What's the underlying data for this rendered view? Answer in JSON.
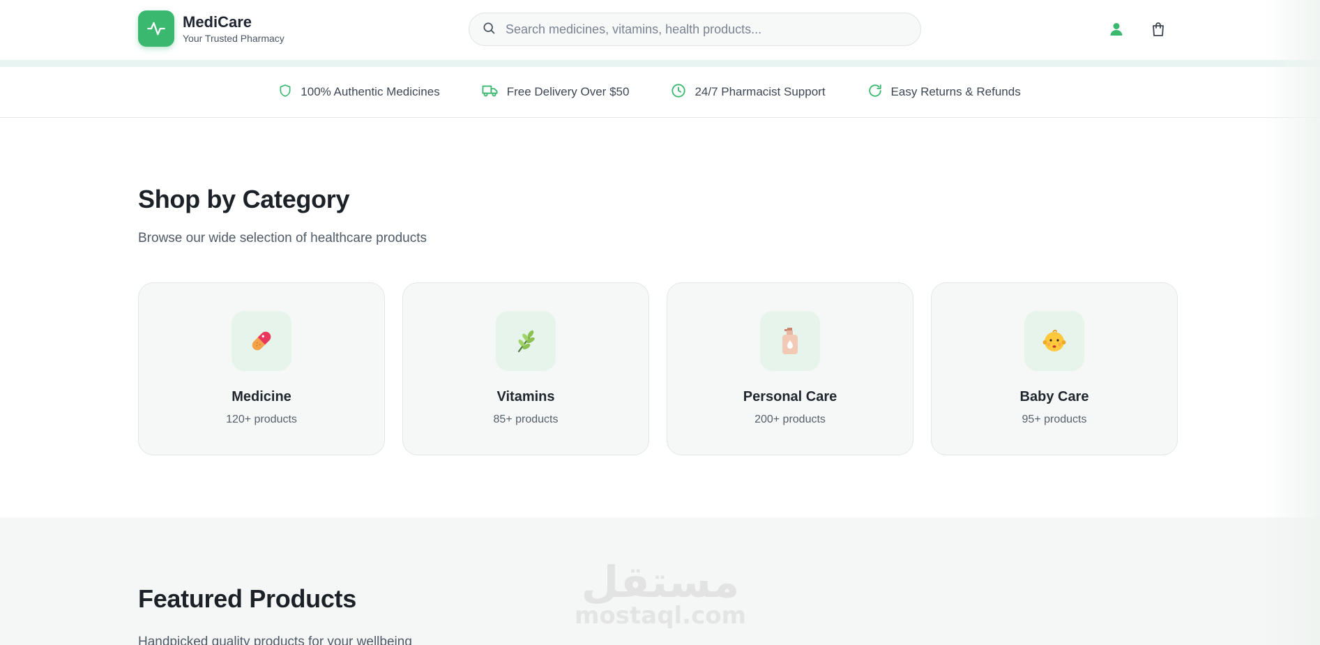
{
  "header": {
    "brand_name": "MediCare",
    "brand_tagline": "Your Trusted Pharmacy",
    "search_placeholder": "Search medicines, vitamins, health products...",
    "accent_color": "#3ab86f"
  },
  "features": [
    {
      "icon": "shield-icon",
      "label": "100% Authentic Medicines"
    },
    {
      "icon": "truck-icon",
      "label": "Free Delivery Over $50"
    },
    {
      "icon": "clock-icon",
      "label": "24/7 Pharmacist Support"
    },
    {
      "icon": "refresh-icon",
      "label": "Easy Returns & Refunds"
    }
  ],
  "categories_section": {
    "title": "Shop by Category",
    "subtitle": "Browse our wide selection of healthcare products",
    "items": [
      {
        "name": "Medicine",
        "count": "120+ products",
        "icon": "pill-icon"
      },
      {
        "name": "Vitamins",
        "count": "85+ products",
        "icon": "herb-icon"
      },
      {
        "name": "Personal Care",
        "count": "200+ products",
        "icon": "lotion-bottle-icon"
      },
      {
        "name": "Baby Care",
        "count": "95+ products",
        "icon": "baby-icon"
      }
    ]
  },
  "featured_section": {
    "title": "Featured Products",
    "subtitle": "Handpicked quality products for your wellbeing"
  },
  "watermark": {
    "arabic": "مستقل",
    "latin": "mostaql.com"
  }
}
